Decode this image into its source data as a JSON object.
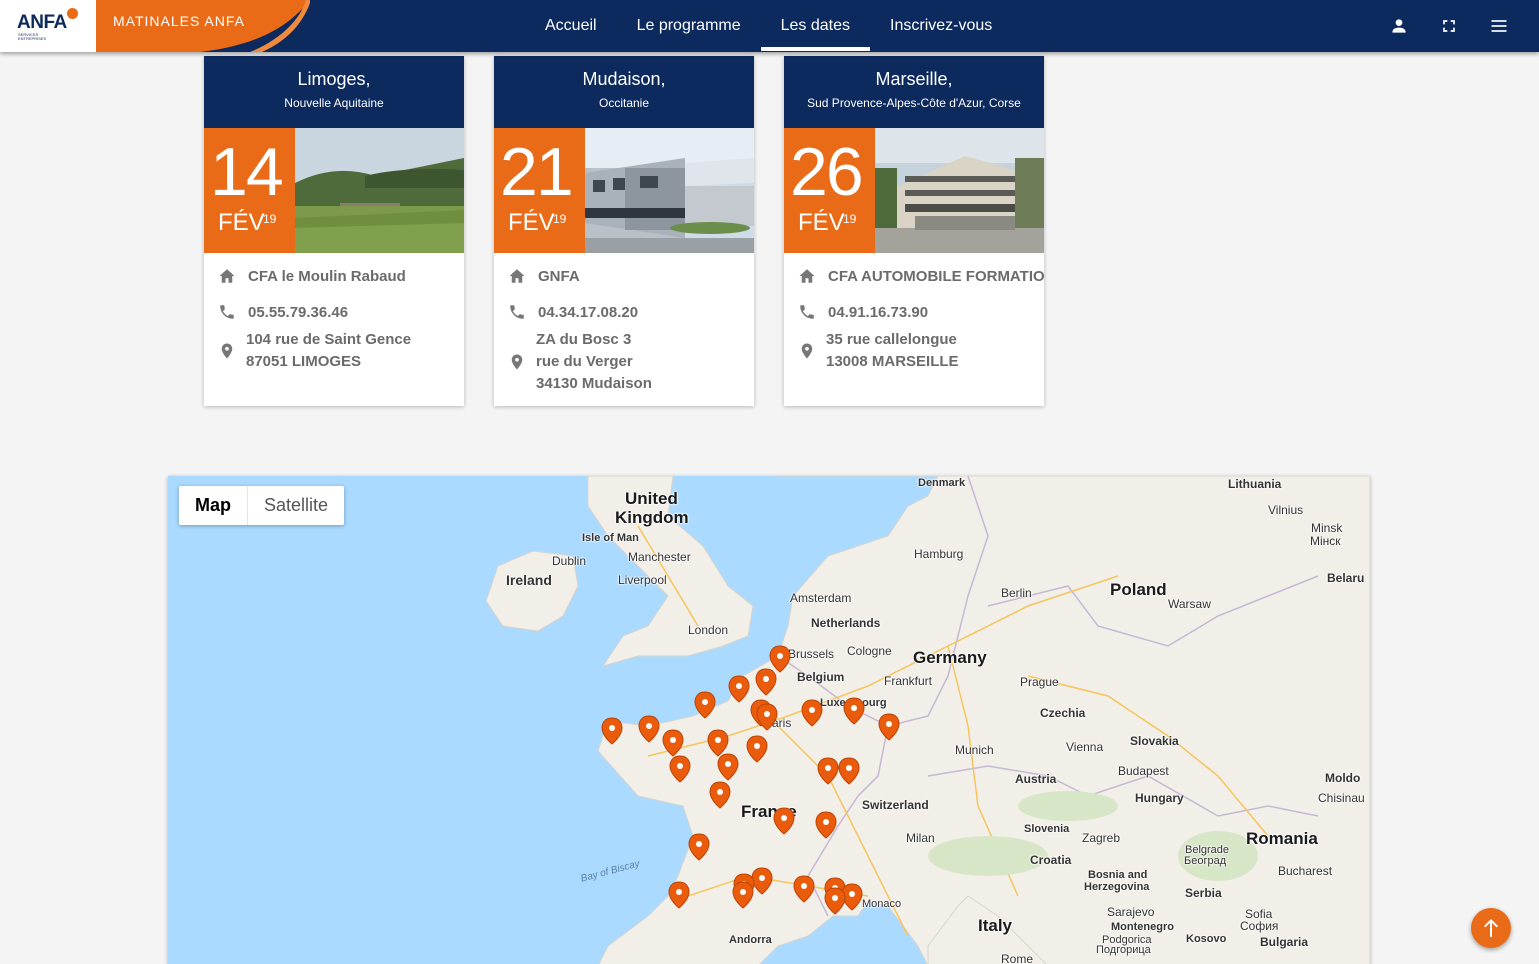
{
  "brand": {
    "logo_text": "ANFA",
    "logo_sub": "SERVICES ENTREPRISES",
    "title": "MATINALES ANFA"
  },
  "nav": {
    "items": [
      {
        "label": "Accueil"
      },
      {
        "label": "Le programme"
      },
      {
        "label": "Les dates",
        "active": true
      },
      {
        "label": "Inscrivez-vous"
      }
    ]
  },
  "toolbar": {
    "icons": [
      "user-icon",
      "fullscreen-icon",
      "menu-icon"
    ]
  },
  "cards": [
    {
      "city": "Limoges,",
      "region": "Nouvelle Aquitaine",
      "day": "14",
      "month": "FÉV",
      "year": "19",
      "name": "CFA le Moulin Rabaud",
      "phone": "05.55.79.36.46",
      "address": [
        "104 rue de Saint Gence",
        "87051 LIMOGES"
      ]
    },
    {
      "city": "Mudaison,",
      "region": "Occitanie",
      "day": "21",
      "month": "FÉV",
      "year": "19",
      "name": "GNFA",
      "phone": "04.34.17.08.20",
      "address": [
        "ZA du Bosc 3",
        "rue du Verger",
        "34130 Mudaison"
      ]
    },
    {
      "city": "Marseille,",
      "region": "Sud Provence-Alpes-Côte d'Azur, Corse",
      "day": "26",
      "month": "FÉV",
      "year": "19",
      "name": "CFA AUTOMOBILE FORMATION",
      "phone": "04.91.16.73.90",
      "address": [
        "35 rue callelongue",
        "13008 MARSEILLE"
      ]
    }
  ],
  "map": {
    "type_buttons": {
      "map": "Map",
      "satellite": "Satellite"
    },
    "labels": {
      "united_kingdom": "United",
      "united_kingdom_2": "Kingdom",
      "isle_of_man": "Isle of Man",
      "dublin": "Dublin",
      "ireland": "Ireland",
      "manchester": "Manchester",
      "liverpool": "Liverpool",
      "london": "London",
      "denmark": "Denmark",
      "lithuania": "Lithuania",
      "vilnius": "Vilnius",
      "minsk": "Minsk",
      "minsk_cyr": "Мінск",
      "belarus": "Belaru",
      "hamburg": "Hamburg",
      "poland": "Poland",
      "berlin": "Berlin",
      "warsaw": "Warsaw",
      "amsterdam": "Amsterdam",
      "netherlands": "Netherlands",
      "brussels": "Brussels",
      "belgium": "Belgium",
      "cologne": "Cologne",
      "germany": "Germany",
      "frankfurt": "Frankfurt",
      "prague": "Prague",
      "luxembourg": "Luxembourg",
      "czechia": "Czechia",
      "paris": "Paris",
      "munich": "Munich",
      "vienna": "Vienna",
      "slovakia": "Slovakia",
      "austria": "Austria",
      "budapest": "Budapest",
      "moldova": "Moldo",
      "hungary": "Hungary",
      "chisinau": "Chisinau",
      "france": "France",
      "switzerland": "Switzerland",
      "milan": "Milan",
      "slovenia": "Slovenia",
      "zagreb": "Zagreb",
      "croatia": "Croatia",
      "romania": "Romania",
      "belgrade": "Belgrade",
      "belgrade_cyr": "Београд",
      "bosnia": "Bosnia and",
      "herzegovina": "Herzegovina",
      "serbia": "Serbia",
      "bucharest": "Bucharest",
      "bay_of_biscay": "Bay of Biscay",
      "monaco": "Monaco",
      "sarajevo": "Sarajevo",
      "montenegro": "Montenegro",
      "sofia": "Sofia",
      "sofia_cyr": "София",
      "podgorica": "Podgorica",
      "podgorica_cyr": "Подгорица",
      "kosovo": "Kosovo",
      "italy": "Italy",
      "bulgaria": "Bulgaria",
      "andorra": "Andorra",
      "rome": "Rome"
    }
  },
  "colors": {
    "navy": "#0d2a5e",
    "orange": "#ea6b17",
    "water": "#aadaff",
    "land": "#f2efe9"
  }
}
